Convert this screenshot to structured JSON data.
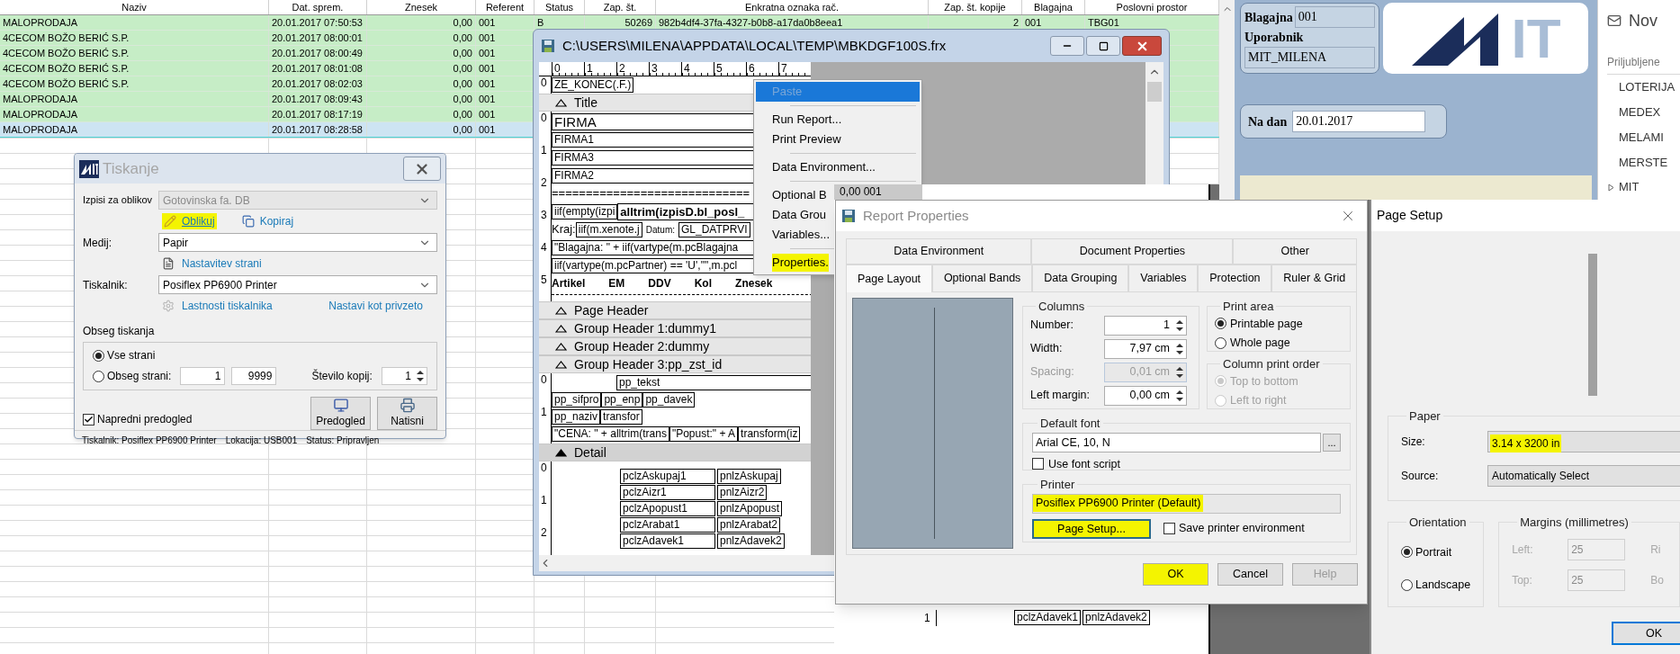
{
  "table": {
    "columns": [
      "Naziv",
      "Dat. sprem.",
      "Znesek",
      "Referent",
      "Status",
      "Zap. št.",
      "Enkratna oznaka rač.",
      "Zap. št. kopije",
      "Blagajna",
      "Poslovni prostor"
    ],
    "rows": [
      {
        "selected": false,
        "cells": [
          "MALOPRODAJA",
          "20.01.2017 07:50:53",
          "0,00",
          "001",
          "B",
          "50269",
          "982b4df4-37fa-4327-b0b8-a17da0b8eea1",
          "2",
          "001",
          "TBG01"
        ]
      },
      {
        "selected": false,
        "cells": [
          "4CECOM BOŽO BERIĆ S.P.",
          "20.01.2017 08:00:01",
          "0,00",
          "001"
        ]
      },
      {
        "selected": false,
        "cells": [
          "4CECOM BOŽO BERIĆ S.P.",
          "20.01.2017 08:00:49",
          "0,00",
          "001"
        ]
      },
      {
        "selected": false,
        "cells": [
          "4CECOM BOŽO BERIĆ S.P.",
          "20.01.2017 08:01:08",
          "0,00",
          "001"
        ]
      },
      {
        "selected": false,
        "cells": [
          "4CECOM BOŽO BERIĆ S.P.",
          "20.01.2017 08:02:03",
          "0,00",
          "001"
        ]
      },
      {
        "selected": false,
        "cells": [
          "MALOPRODAJA",
          "20.01.2017 08:09:43",
          "0,00",
          "001"
        ]
      },
      {
        "selected": false,
        "cells": [
          "MALOPRODAJA",
          "20.01.2017 08:17:19",
          "0,00",
          "001"
        ]
      },
      {
        "selected": true,
        "cells": [
          "MALOPRODAJA",
          "20.01.2017 08:28:58",
          "0,00",
          "001"
        ]
      }
    ]
  },
  "print_dialog": {
    "title": "Tiskanje",
    "template": {
      "label": "Izpisi za oblikov",
      "value": "Gotovinska fa. DB",
      "disabled": true
    },
    "actions": [
      {
        "label": "Oblikuj",
        "kind": "design",
        "highlighted": true
      },
      {
        "label": "Kopiraj",
        "kind": "copy",
        "highlighted": false
      }
    ],
    "medium": {
      "label": "Medij:",
      "value": "Papir",
      "disabled": false
    },
    "page_setup_link": "Nastavitev strani",
    "printer": {
      "label": "Tiskalnik:",
      "value": "Posiflex PP6900 Printer",
      "disabled": false
    },
    "printer_properties_link": "Lastnosti tiskalnika",
    "set_default_link": "Nastavi kot privzeto",
    "range": {
      "title": "Obseg tiskanja",
      "options": [
        {
          "label": "Vse strani",
          "selected": true
        },
        {
          "label": "Obseg strani:",
          "selected": false
        }
      ],
      "from": "1",
      "to": "9999",
      "copies_label": "Število kopij:",
      "copies": "1"
    },
    "advanced_preview": {
      "label": "Napredni predogled",
      "checked": true
    },
    "buttons": [
      {
        "label": "Predogled",
        "kind": "preview"
      },
      {
        "label": "Natisni",
        "kind": "print"
      }
    ],
    "status_bar": [
      "Tiskalnik: Posiflex PP6900 Printer",
      "Lokacija: USB001",
      "Status: Pripravljen"
    ]
  },
  "designer": {
    "title": "C:\\USERS\\MILENA\\APPDATA\\LOCAL\\TEMP\\MBKDGF100S.frx",
    "ruler": [
      "0",
      "1",
      "2",
      "3",
      "4",
      "5",
      "6",
      "7"
    ],
    "sections": [
      {
        "kind": "fields",
        "ruler": [
          "0"
        ],
        "rows": [
          [
            {
              "kind": "field",
              "text": "ZE_KONEC(.F.)"
            }
          ]
        ]
      },
      {
        "kind": "band",
        "label": "Title",
        "selected": false
      },
      {
        "kind": "fields",
        "ruler": [
          "0",
          "1",
          "2",
          "3",
          "4",
          "5"
        ],
        "rows": [
          [
            {
              "kind": "large_field",
              "text": "FIRMA"
            }
          ],
          [
            {
              "kind": "wide_field",
              "text": "FIRMA1"
            }
          ],
          [
            {
              "kind": "wide_field",
              "text": "FIRMA3"
            }
          ],
          [
            {
              "kind": "wide_field",
              "text": "FIRMA2"
            }
          ],
          [
            {
              "kind": "rule",
              "text": "============================="
            }
          ],
          [
            {
              "kind": "field",
              "text": "iif(empty(izpi"
            },
            {
              "kind": "bold_field",
              "text": "alltrim(izpisD.bl_posl_"
            }
          ],
          [
            {
              "kind": "label",
              "text": "Kraj:"
            },
            {
              "kind": "field",
              "text": "iif(m.xenote.j"
            },
            {
              "kind": "small_label",
              "text": "Datum:"
            },
            {
              "kind": "field",
              "text": "GL_DATPRVI"
            }
          ],
          [
            {
              "kind": "wide_field",
              "text": "\"Blagajna: \" + iif(vartype(m.pcBlagajna"
            }
          ],
          [
            {
              "kind": "wide_field",
              "text": "iif(vartype(m.pcPartner) == 'U',\"\",m.pcl"
            }
          ],
          [
            {
              "kind": "bold_label",
              "text": "Artikel"
            },
            {
              "kind": "bold_label",
              "text": "EM"
            },
            {
              "kind": "bold_label",
              "text": "DDV"
            },
            {
              "kind": "bold_label",
              "text": "Kol"
            },
            {
              "kind": "bold_label",
              "text": "Znesek"
            }
          ]
        ]
      },
      {
        "kind": "band",
        "label": "Page Header",
        "selected": false
      },
      {
        "kind": "band",
        "label": "Group Header 1:dummy1",
        "selected": false
      },
      {
        "kind": "band",
        "label": "Group Header 2:dummy",
        "selected": false
      },
      {
        "kind": "band",
        "label": "Group Header 3:pp_zst_id",
        "selected": false
      },
      {
        "kind": "fields",
        "ruler": [
          "0",
          "1"
        ],
        "rows": [
          [
            {
              "kind": "indent_field",
              "text": "pp_tekst"
            }
          ],
          [
            {
              "kind": "field",
              "text": "pp_sifpro"
            },
            {
              "kind": "field",
              "text": "pp_enp"
            },
            {
              "kind": "field",
              "text": "pp_davek"
            }
          ],
          [
            {
              "kind": "field",
              "text": "pp_naziv"
            },
            {
              "kind": "field",
              "text": "transfor"
            }
          ],
          [
            {
              "kind": "field",
              "text": "\"CENA: \" + alltrim(trans"
            },
            {
              "kind": "field",
              "text": "\"Popust:\" + A"
            },
            {
              "kind": "field",
              "text": "transform(iz"
            }
          ]
        ]
      },
      {
        "kind": "band",
        "label": "Detail",
        "selected": true
      },
      {
        "kind": "grid",
        "ruler": [
          "0",
          "1",
          "2"
        ],
        "rows": [
          [
            {
              "kind": "grid_field",
              "text": "pclzAskupaj1"
            },
            {
              "kind": "field",
              "text": "pnlzAskupaj"
            }
          ],
          [
            {
              "kind": "grid_field",
              "text": "pclzAizr1"
            },
            {
              "kind": "field",
              "text": "pnlzAizr2"
            }
          ],
          [
            {
              "kind": "grid_field",
              "text": "pclzApopust1"
            },
            {
              "kind": "field",
              "text": "pnlzApopust"
            }
          ],
          [
            {
              "kind": "grid_field",
              "text": "pclzArabat1"
            },
            {
              "kind": "field",
              "text": "pnlzArabat2"
            }
          ],
          [
            {
              "kind": "grid_field",
              "text": "pclzAdavek1"
            },
            {
              "kind": "field",
              "text": "pnlzAdavek2"
            }
          ]
        ]
      }
    ]
  },
  "context_menu": {
    "items": [
      {
        "kind": "item",
        "text": "Paste",
        "selected": true,
        "disabled": true,
        "highlighted": false
      },
      {
        "kind": "separator"
      },
      {
        "kind": "item",
        "text": "Run Report...",
        "selected": false,
        "disabled": false,
        "highlighted": false
      },
      {
        "kind": "item",
        "text": "Print Preview",
        "selected": false,
        "disabled": false,
        "highlighted": false
      },
      {
        "kind": "separator"
      },
      {
        "kind": "item",
        "text": "Data Environment...",
        "selected": false,
        "disabled": false,
        "highlighted": false
      },
      {
        "kind": "separator"
      },
      {
        "kind": "item",
        "text": "Optional B",
        "selected": false,
        "disabled": false,
        "highlighted": false
      },
      {
        "kind": "item",
        "text": "Data Grou",
        "selected": false,
        "disabled": false,
        "highlighted": false
      },
      {
        "kind": "item",
        "text": "Variables...",
        "selected": false,
        "disabled": false,
        "highlighted": false
      },
      {
        "kind": "separator"
      },
      {
        "kind": "item",
        "text": "Properties.",
        "selected": false,
        "disabled": false,
        "highlighted": true
      }
    ]
  },
  "behind_window": {
    "value_cell": "0,00 001",
    "ruler": "1",
    "fields": [
      "pclzAdavek1",
      "pnlzAdavek2"
    ]
  },
  "report_properties": {
    "title": "Report Properties",
    "tab_rows": [
      [
        {
          "label": "Data Environment",
          "selected": false
        },
        {
          "label": "Document Properties",
          "selected": false
        },
        {
          "label": "Other",
          "selected": false
        }
      ],
      [
        {
          "label": "Page Layout",
          "selected": true
        },
        {
          "label": "Optional Bands",
          "selected": false
        },
        {
          "label": "Data Grouping",
          "selected": false
        },
        {
          "label": "Variables",
          "selected": false
        },
        {
          "label": "Protection",
          "selected": false
        },
        {
          "label": "Ruler & Grid",
          "selected": false
        }
      ]
    ],
    "columns": {
      "title": "Columns",
      "fields": [
        {
          "label": "Number:",
          "value": "1",
          "disabled": false
        },
        {
          "label": "Width:",
          "value": "7,97 cm",
          "disabled": false
        },
        {
          "label": "Spacing:",
          "value": "0,01 cm",
          "disabled": true
        },
        {
          "label": "Left margin:",
          "value": "0,00 cm",
          "disabled": false
        }
      ]
    },
    "print_area": {
      "title": "Print area",
      "disabled": false,
      "options": [
        {
          "label": "Printable page",
          "selected": true
        },
        {
          "label": "Whole page",
          "selected": false
        }
      ]
    },
    "column_print_order": {
      "title": "Column print order",
      "disabled": true,
      "options": [
        {
          "label": "Top to bottom",
          "selected": true
        },
        {
          "label": "Left to right",
          "selected": false
        }
      ]
    },
    "default_font": {
      "title": "Default font",
      "value": "Arial CE, 10, N",
      "browse": "...",
      "use_font_script": {
        "label": "Use font script",
        "checked": false
      }
    },
    "printer": {
      "title": "Printer",
      "value": "Posiflex PP6900 Printer (Default)",
      "highlighted": true,
      "page_setup": {
        "label": "Page Setup...",
        "highlighted": true
      },
      "save_environment": {
        "label": "Save printer environment",
        "checked": false
      }
    },
    "buttons": [
      {
        "label": "OK",
        "highlighted": true,
        "disabled": false
      },
      {
        "label": "Cancel",
        "highlighted": false,
        "disabled": false
      },
      {
        "label": "Help",
        "highlighted": false,
        "disabled": true
      }
    ]
  },
  "page_setup": {
    "title": "Page Setup",
    "paper": {
      "title": "Paper",
      "size_label": "Size:",
      "size": "3.14 x 3200 in",
      "size_highlighted": true,
      "source_label": "Source:",
      "source": "Automatically Select"
    },
    "orientation": {
      "title": "Orientation",
      "options": [
        {
          "label": "Portrait",
          "selected": true
        },
        {
          "label": "Landscape",
          "selected": false
        }
      ]
    },
    "margins": {
      "title": "Margins (millimetres)",
      "disabled": true,
      "fields": [
        {
          "label": "Left:",
          "value": "25",
          "side_label": "Ri"
        },
        {
          "label": "Top:",
          "value": "25",
          "side_label": "Bo"
        }
      ]
    },
    "ok": "OK"
  },
  "mit_panel": {
    "cash_register_label": "Blagajna",
    "cash_register": "001",
    "user_label": "Uporabnik",
    "user": "MIT_MILENA",
    "logo_text": "IT",
    "date_label": "Na dan",
    "date": "20.01.2017"
  },
  "side_list": {
    "header": "Nov",
    "section": "Priljubljene",
    "items": [
      {
        "kind": "leaf",
        "label": "LOTERIJA"
      },
      {
        "kind": "leaf",
        "label": "MEDEX"
      },
      {
        "kind": "leaf",
        "label": "MELAMI"
      },
      {
        "kind": "leaf",
        "label": "MERSTE"
      },
      {
        "kind": "folder",
        "label": "MIT",
        "expanded": false
      }
    ]
  }
}
